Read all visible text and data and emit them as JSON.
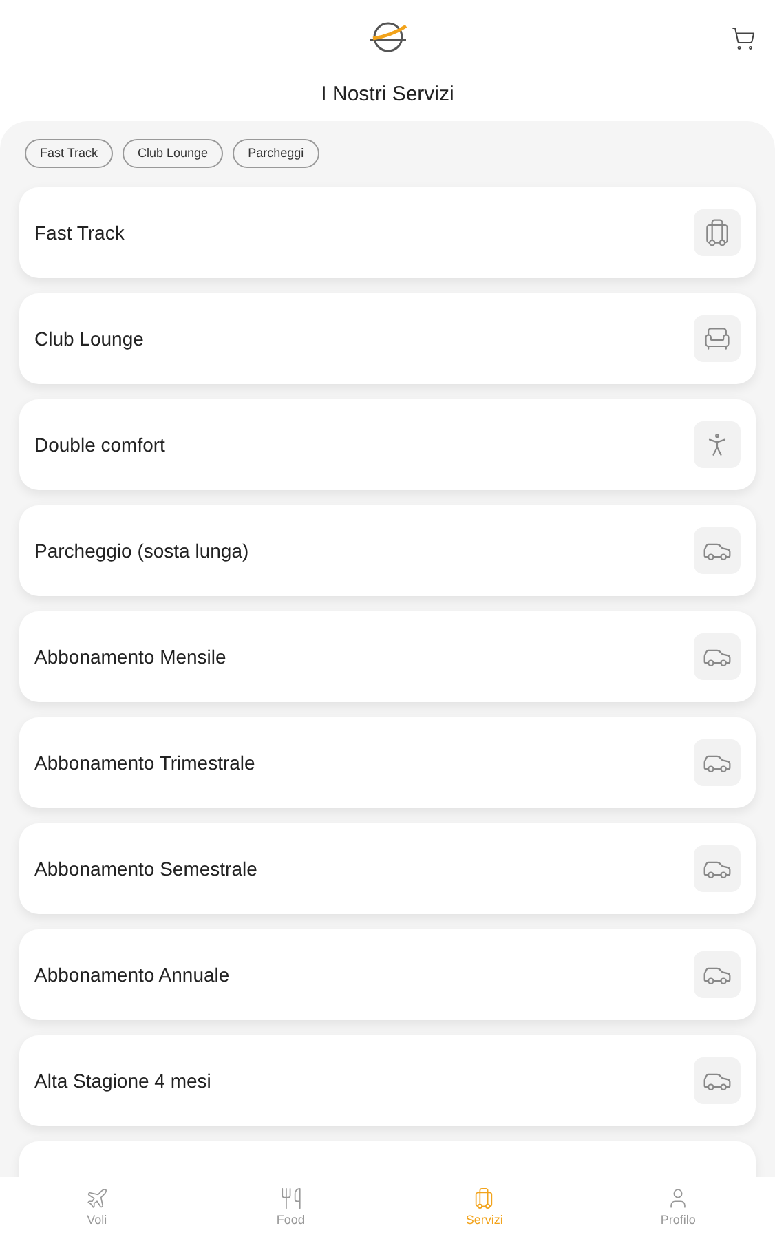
{
  "header": {
    "title": "I Nostri Servizi"
  },
  "filters": [
    {
      "label": "Fast Track"
    },
    {
      "label": "Club Lounge"
    },
    {
      "label": "Parcheggi"
    }
  ],
  "services": [
    {
      "name": "Fast Track",
      "kind": "walker"
    },
    {
      "name": "Club Lounge",
      "kind": "lounge"
    },
    {
      "name": "Double comfort",
      "kind": "combo"
    },
    {
      "name": "Parcheggio (sosta lunga)",
      "kind": "car"
    },
    {
      "name": "Abbonamento Mensile",
      "kind": "car"
    },
    {
      "name": "Abbonamento Trimestrale",
      "kind": "car"
    },
    {
      "name": "Abbonamento Semestrale",
      "kind": "car"
    },
    {
      "name": "Abbonamento Annuale",
      "kind": "car"
    },
    {
      "name": "Alta Stagione 4 mesi",
      "kind": "car"
    }
  ],
  "nav": [
    {
      "label": "Voli",
      "kind": "plane",
      "selected": false
    },
    {
      "label": "Food",
      "kind": "food",
      "selected": false
    },
    {
      "label": "Servizi",
      "kind": "walker",
      "selected": true
    },
    {
      "label": "Profilo",
      "kind": "user",
      "selected": false
    }
  ]
}
